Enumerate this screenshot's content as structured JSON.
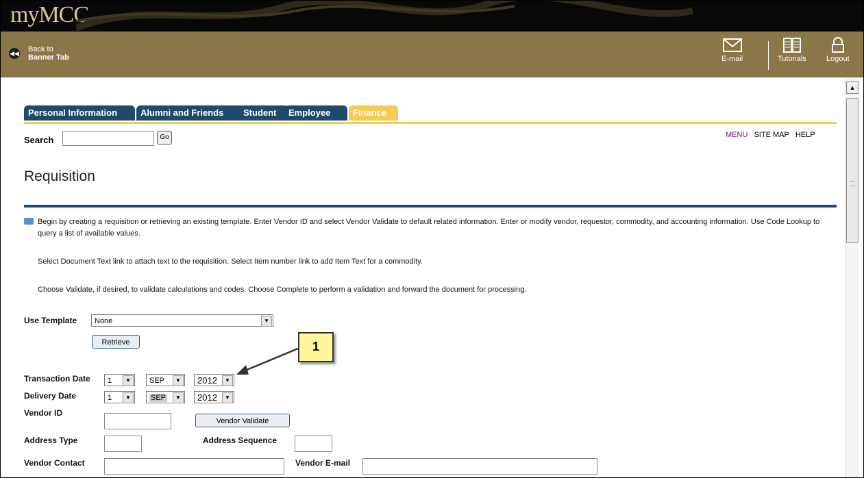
{
  "header": {
    "logo_text": "myMCC",
    "back_line1": "Back to",
    "back_line2": "Banner Tab",
    "tools": [
      {
        "label": "E-mail",
        "icon": "envelope-icon"
      },
      {
        "label": "Tutorials",
        "icon": "book-icon"
      },
      {
        "label": "Logout",
        "icon": "lock-icon"
      }
    ]
  },
  "tabs": [
    {
      "label": "Personal Information",
      "active": false
    },
    {
      "label": "Alumni and Friends",
      "active": false
    },
    {
      "label": "Student",
      "active": false
    },
    {
      "label": "Employee",
      "active": false
    },
    {
      "label": "Finance",
      "active": true
    }
  ],
  "search": {
    "label": "Search",
    "value": "",
    "go_label": "Go"
  },
  "top_links": [
    "MENU",
    "SITE MAP",
    "HELP"
  ],
  "page_title": "Requisition",
  "instructions": {
    "p1": "Begin by creating a requisition or retrieving an existing template. Enter Vendor ID and select Vendor Validate to default related information. Enter or modify vendor, requestor, commodity, and accounting information. Use Code Lookup to query a list of available values.",
    "p2": "Select Document Text link to attach text to the requisition. Select Item number link to add Item Text for a commodity.",
    "p3": "Choose Validate, if desired, to validate calculations and codes. Choose Complete to perform a validation and forward the document for processing."
  },
  "form": {
    "use_template_label": "Use Template",
    "use_template_value": "None",
    "retrieve_label": "Retrieve",
    "transaction_date_label": "Transaction Date",
    "transaction_date": {
      "day": "1",
      "month": "SEP",
      "year": "2012"
    },
    "delivery_date_label": "Delivery Date",
    "delivery_date": {
      "day": "1",
      "month": "SEP",
      "year": "2012"
    },
    "vendor_id_label": "Vendor ID",
    "vendor_id_value": "",
    "vendor_validate_label": "Vendor Validate",
    "address_type_label": "Address Type",
    "address_sequence_label": "Address Sequence",
    "vendor_contact_label": "Vendor Contact",
    "vendor_email_label": "Vendor E-mail"
  },
  "callout": {
    "number": "1"
  },
  "colors": {
    "gold": "#8b7647",
    "tab_blue": "#1e4a6e",
    "tab_active": "#f3cb55",
    "callout": "#fff799"
  }
}
